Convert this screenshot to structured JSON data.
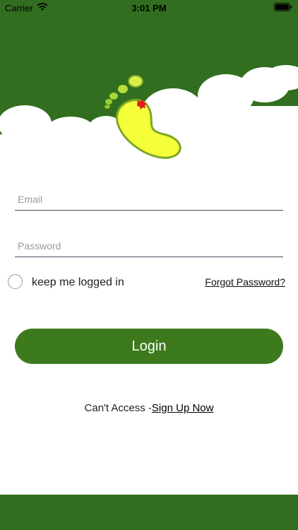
{
  "status_bar": {
    "carrier": "Carrier",
    "time": "3:01 PM"
  },
  "colors": {
    "header_bg": "#326e1f",
    "button_bg": "#3d7a1e",
    "footer_bg": "#326e1f",
    "foot_fill": "#f5ff3a",
    "foot_outline": "#7ba72a",
    "cloud": "#ffffff"
  },
  "header": {
    "logo_icon": "footprint-icon"
  },
  "form": {
    "email_placeholder": "Email",
    "password_placeholder": "Password",
    "email_value": "",
    "password_value": "",
    "remember_label": "keep me logged in",
    "remember_checked": false,
    "forgot_label": "Forgot Password?",
    "login_label": "Login"
  },
  "signup": {
    "prefix": "Can't Access -",
    "link_label": "Sign Up Now"
  }
}
